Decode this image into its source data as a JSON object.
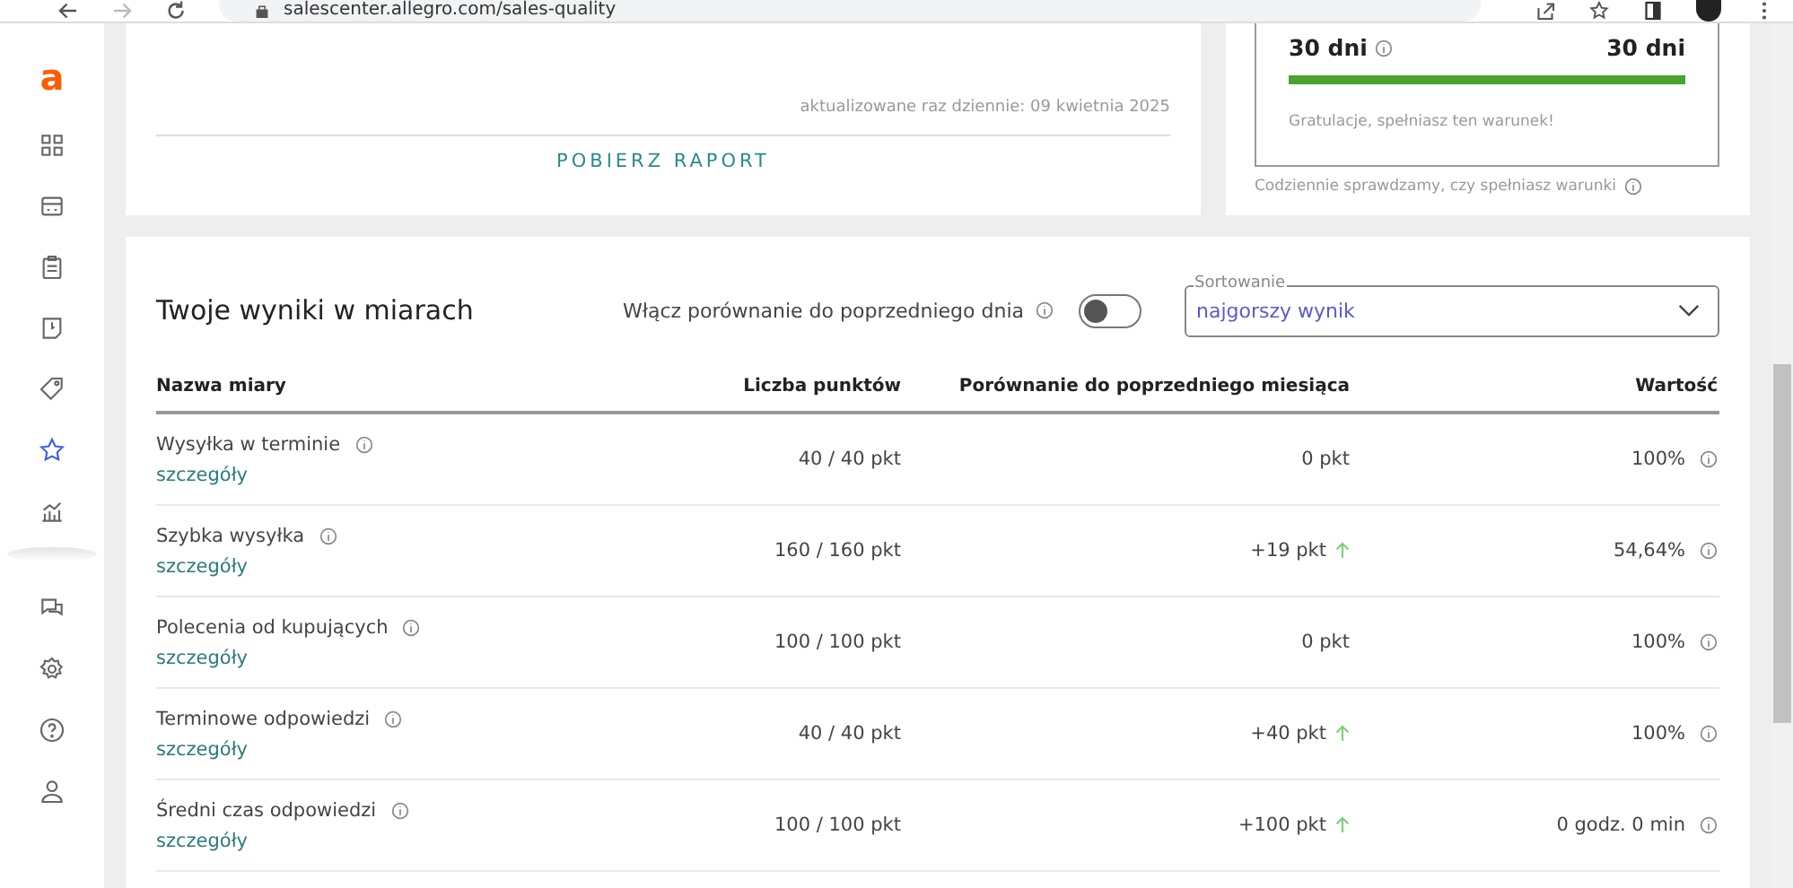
{
  "browser": {
    "url": "salescenter.allegro.com/sales-quality"
  },
  "sidebar": {
    "logo": "a",
    "items": [
      {
        "kind": "grid",
        "selected": false
      },
      {
        "kind": "box",
        "selected": false
      },
      {
        "kind": "clipboard",
        "selected": false
      },
      {
        "kind": "document",
        "selected": false
      },
      {
        "kind": "tag",
        "selected": false
      },
      {
        "kind": "star",
        "selected": true
      },
      {
        "kind": "chart",
        "selected": false
      }
    ],
    "bottom_items": [
      {
        "kind": "chat",
        "selected": false
      },
      {
        "kind": "gear",
        "selected": false
      },
      {
        "kind": "help",
        "selected": false
      },
      {
        "kind": "user",
        "selected": false
      }
    ]
  },
  "report_card": {
    "updated": "aktualizowane raz dziennie: 09 kwietnia 2025",
    "download_button": "POBIERZ RAPORT"
  },
  "condition_card": {
    "current": "30 dni",
    "target": "30 dni",
    "level": 1,
    "message": "Gratulacje, spełniasz ten warunek!",
    "note": "Codziennie sprawdzamy, czy spełniasz warunki"
  },
  "results": {
    "title": "Twoje wyniki w miarach",
    "compare_toggle": {
      "label": "Włącz porównanie do poprzedniego dnia",
      "on": false
    },
    "sort": {
      "label": "Sortowanie",
      "value": "najgorszy wynik"
    },
    "columns": [
      "Nazwa miary",
      "Liczba punktów",
      "Porównanie do poprzedniego miesiąca",
      "Wartość"
    ],
    "rows": [
      {
        "name": "Wysyłka w terminie",
        "link": "szczegóły",
        "points": "40 / 40 pkt",
        "comparison": "0 pkt",
        "kind": "flat",
        "value": "100%"
      },
      {
        "name": "Szybka wysyłka",
        "link": "szczegóły",
        "points": "160 / 160 pkt",
        "comparison": "+19 pkt",
        "kind": "up",
        "value": "54,64%"
      },
      {
        "name": "Polecenia od kupujących",
        "link": "szczegóły",
        "points": "100 / 100 pkt",
        "comparison": "0 pkt",
        "kind": "flat",
        "value": "100%"
      },
      {
        "name": "Terminowe odpowiedzi",
        "link": "szczegóły",
        "points": "40 / 40 pkt",
        "comparison": "+40 pkt",
        "kind": "up",
        "value": "100%"
      },
      {
        "name": "Średni czas odpowiedzi",
        "link": "szczegóły",
        "points": "100 / 100 pkt",
        "comparison": "+100 pkt",
        "kind": "up",
        "value": "0 godz. 0 min"
      }
    ]
  }
}
